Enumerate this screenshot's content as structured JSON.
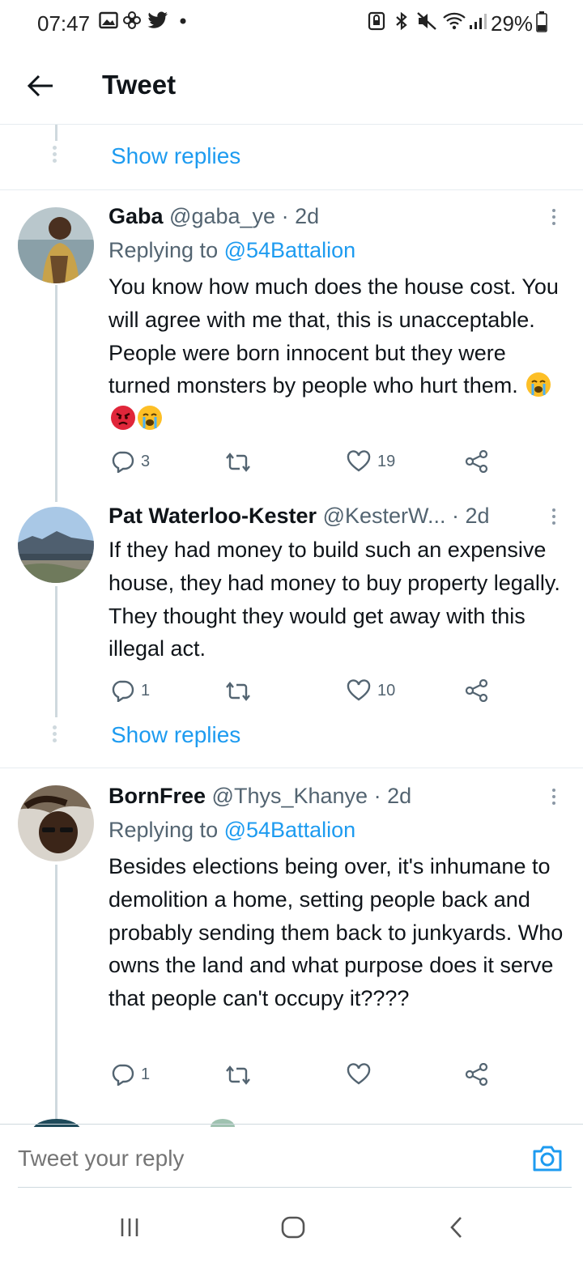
{
  "status_bar": {
    "time": "07:47",
    "battery": "29%",
    "left_icons": [
      "gallery-icon",
      "fan-icon",
      "twitter-bird-icon",
      "dot-icon"
    ],
    "right_icons": [
      "lock-icon",
      "bluetooth-icon",
      "mute-icon",
      "wifi-icon",
      "signal-icon",
      "battery-icon"
    ]
  },
  "header": {
    "title": "Tweet",
    "back_icon": "arrow-left-icon"
  },
  "thread": {
    "show_replies_top": "Show replies",
    "show_replies_mid": "Show replies"
  },
  "tweets": [
    {
      "name": "Gaba",
      "handle": "@gaba_ye",
      "time": "· 2d",
      "replying_prefix": "Replying to",
      "replying_to": "@54Battalion",
      "text": "You know how much does the house cost. You will agree with me that, this is unacceptable. People were born innocent but they were turned monsters by people who hurt them.",
      "emojis": [
        "loudly-crying-face",
        "angry-face",
        "loudly-crying-face"
      ],
      "replies": "3",
      "retweets": "",
      "likes": "19"
    },
    {
      "name": "Pat Waterloo-Kester",
      "handle": "@KesterW...",
      "time": "· 2d",
      "text": "If they had money to build such an expensive house, they had money to buy property legally. They thought they would get away with this illegal act.",
      "replies": "1",
      "retweets": "",
      "likes": "10"
    },
    {
      "name": "BornFree",
      "handle": "@Thys_Khanye",
      "time": "· 2d",
      "replying_prefix": "Replying to",
      "replying_to": "@54Battalion",
      "text": "Besides elections being over, it's inhumane to demolition a home, setting people back and probably sending them back to junkyards. Who owns the land and what purpose does it serve that people can't occupy it????",
      "replies": "1",
      "retweets": "",
      "likes": ""
    }
  ],
  "reply_bar": {
    "placeholder": "Tweet your reply",
    "camera_icon": "camera-icon"
  },
  "nav_bar": {
    "buttons": [
      "recent-apps-icon",
      "home-icon",
      "back-icon"
    ]
  },
  "colors": {
    "accent": "#1d9bf0",
    "text": "#0f1419",
    "muted": "#536471",
    "divider": "#e6ecf0"
  }
}
